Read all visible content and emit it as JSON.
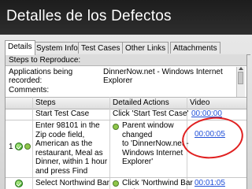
{
  "slide": {
    "title": "Detalles de los Defectos"
  },
  "tabs": [
    {
      "label": "Details",
      "active": true
    },
    {
      "label": "System Info",
      "active": false
    },
    {
      "label": "Test Cases",
      "active": false
    },
    {
      "label": "Other Links",
      "active": false
    },
    {
      "label": "Attachments",
      "active": false
    }
  ],
  "details": {
    "steps_to_reproduce_label": "Steps to Reproduce:",
    "applications_label_1": "Applications being",
    "applications_label_2": "recorded:",
    "applications_value_1": "DinnerNow.net - Windows Internet",
    "applications_value_2": "Explorer",
    "comments_label": "Comments:"
  },
  "grid": {
    "columns": [
      "Steps",
      "Detailed Actions",
      "Video"
    ],
    "rows": [
      {
        "number": "",
        "steps": [
          "Start Test Case"
        ],
        "actions": [
          "Click 'Start Test Case'"
        ],
        "video": "00:00:00"
      },
      {
        "number": "1",
        "steps": [
          "Enter 98101 in the",
          "Zip code field,",
          "American as the",
          "restaurant, Meal as",
          "Dinner, within 1 hour",
          "and press Find"
        ],
        "actions": [
          "Parent window changed",
          "to 'DinnerNow.net -",
          "Windows Internet",
          "Explorer'"
        ],
        "video": "00:00:05"
      },
      {
        "number": "",
        "steps": [
          "Select Northwind Bar"
        ],
        "actions": [
          "Click 'Northwind Bar and"
        ],
        "video": "00:01:05"
      }
    ]
  },
  "colors": {
    "title_bar": "#1d1d1d",
    "link": "#1f4fd8",
    "highlight": "#e02020",
    "status_ok": "#2f9a1b"
  },
  "icons": {
    "status": "pass-check-icon",
    "attachment": "status-dot-icon"
  }
}
